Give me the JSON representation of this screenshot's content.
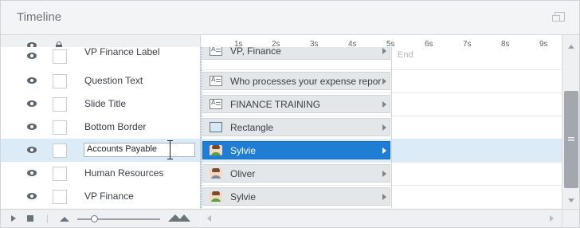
{
  "panel": {
    "title": "Timeline",
    "restore_icon": "restore-window-icon"
  },
  "columns": {
    "visibility_icon": "eye-icon",
    "lock_icon": "lock-icon"
  },
  "ruler": {
    "labels": [
      "1s",
      "2s",
      "3s",
      "4s",
      "5s",
      "6s",
      "7s",
      "8s",
      "9s"
    ]
  },
  "layers": [
    {
      "name": "VP Finance Label",
      "bar_text": "VP, Finance",
      "icon": "text-caption-icon",
      "partial": true
    },
    {
      "name": "Question Text",
      "bar_text": "Who processes your expense repor...",
      "icon": "text-caption-icon"
    },
    {
      "name": "Slide Title",
      "bar_text": "FINANCE TRAINING",
      "icon": "text-caption-icon"
    },
    {
      "name": "Bottom Border",
      "bar_text": "Rectangle",
      "icon": "rectangle-icon"
    },
    {
      "name": "Accounts Payable",
      "bar_text": "Sylvie",
      "icon": "character-sylvie-icon",
      "selected": true,
      "editing": true
    },
    {
      "name": "Human Resources",
      "bar_text": "Oliver",
      "icon": "character-oliver-icon"
    },
    {
      "name": "VP Finance",
      "bar_text": "Sylvie",
      "icon": "character-sylvie-icon"
    }
  ],
  "end_label": "End",
  "footer": {
    "play_icon": "play-icon",
    "stop_icon": "stop-icon",
    "zoom_out_icon": "zoom-out-mountain-icon",
    "zoom_in_icon": "zoom-in-mountain-icon"
  }
}
